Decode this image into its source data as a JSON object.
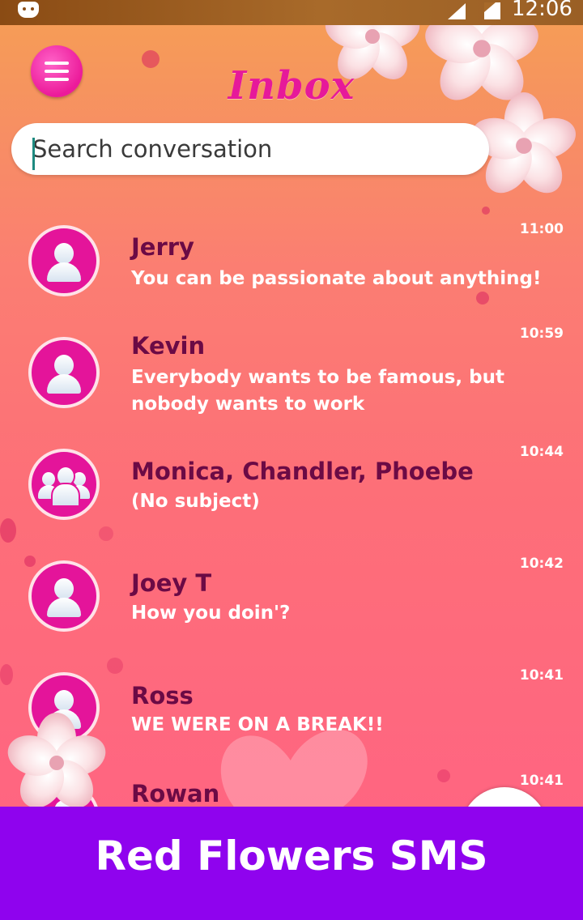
{
  "status_bar": {
    "time": "12:06"
  },
  "header": {
    "title": "Inbox"
  },
  "search": {
    "placeholder": "Search conversation"
  },
  "conversations": [
    {
      "name": "Jerry",
      "snippet": " You can be passionate about anything!",
      "time": "11:00",
      "avatar": "person-icon"
    },
    {
      "name": "Kevin",
      "snippet": " Everybody wants to be famous, but nobody wants to work",
      "time": "10:59",
      "avatar": "person-icon"
    },
    {
      "name": "Monica, Chandler, Phoebe",
      "snippet": "(No subject)",
      "time": "10:44",
      "avatar": "group-icon"
    },
    {
      "name": "Joey T",
      "snippet": "How you doin'?",
      "time": "10:42",
      "avatar": "person-icon"
    },
    {
      "name": "Ross",
      "snippet": "WE WERE ON A BREAK!!",
      "time": "10:41",
      "avatar": "person-icon"
    },
    {
      "name": "Rowan",
      "snippet": "",
      "time": "10:41",
      "avatar": "person-icon"
    }
  ],
  "banner": {
    "text": "Red Flowers SMS"
  },
  "colors": {
    "accent": "#e6199a",
    "name_text": "#6b0a45",
    "banner": "#8f03ee"
  }
}
